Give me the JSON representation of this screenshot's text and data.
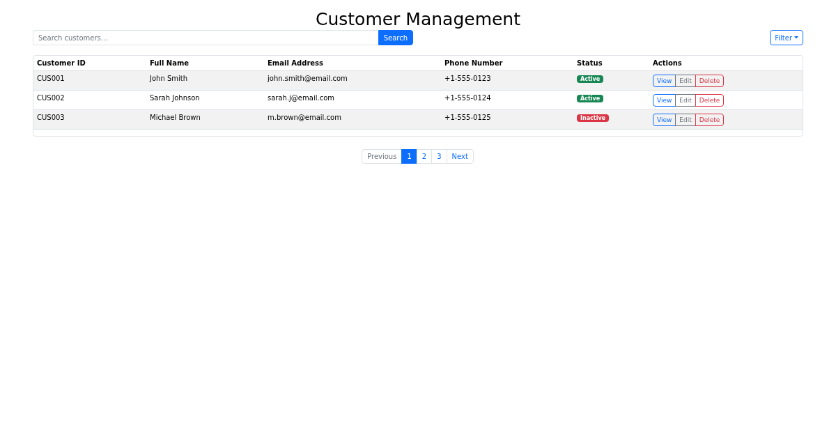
{
  "title": "Customer Management",
  "search": {
    "placeholder": "Search customers...",
    "button": "Search"
  },
  "filter": {
    "label": "Filter"
  },
  "table": {
    "columns": [
      "Customer ID",
      "Full Name",
      "Email Address",
      "Phone Number",
      "Status",
      "Actions"
    ],
    "rows": [
      {
        "id": "CUS001",
        "name": "John Smith",
        "email": "john.smith@email.com",
        "phone": "+1-555-0123",
        "status": {
          "label": "Active",
          "color": "#198754"
        },
        "actions": [
          {
            "kind": "view",
            "label": "View"
          },
          {
            "kind": "edit",
            "label": "Edit"
          },
          {
            "kind": "delete",
            "label": "Delete"
          }
        ]
      },
      {
        "id": "CUS002",
        "name": "Sarah Johnson",
        "email": "sarah.j@email.com",
        "phone": "+1-555-0124",
        "status": {
          "label": "Active",
          "color": "#198754"
        },
        "actions": [
          {
            "kind": "view",
            "label": "View"
          },
          {
            "kind": "edit",
            "label": "Edit"
          },
          {
            "kind": "delete",
            "label": "Delete"
          }
        ]
      },
      {
        "id": "CUS003",
        "name": "Michael Brown",
        "email": "m.brown@email.com",
        "phone": "+1-555-0125",
        "status": {
          "label": "Inactive",
          "color": "#dc3545"
        },
        "actions": [
          {
            "kind": "view",
            "label": "View"
          },
          {
            "kind": "edit",
            "label": "Edit"
          },
          {
            "kind": "delete",
            "label": "Delete"
          }
        ]
      }
    ]
  },
  "pagination": {
    "previous": {
      "label": "Previous",
      "disabled": true
    },
    "pages": [
      {
        "label": "1",
        "selected": true
      },
      {
        "label": "2",
        "selected": false
      },
      {
        "label": "3",
        "selected": false
      }
    ],
    "next": {
      "label": "Next",
      "disabled": false
    }
  }
}
